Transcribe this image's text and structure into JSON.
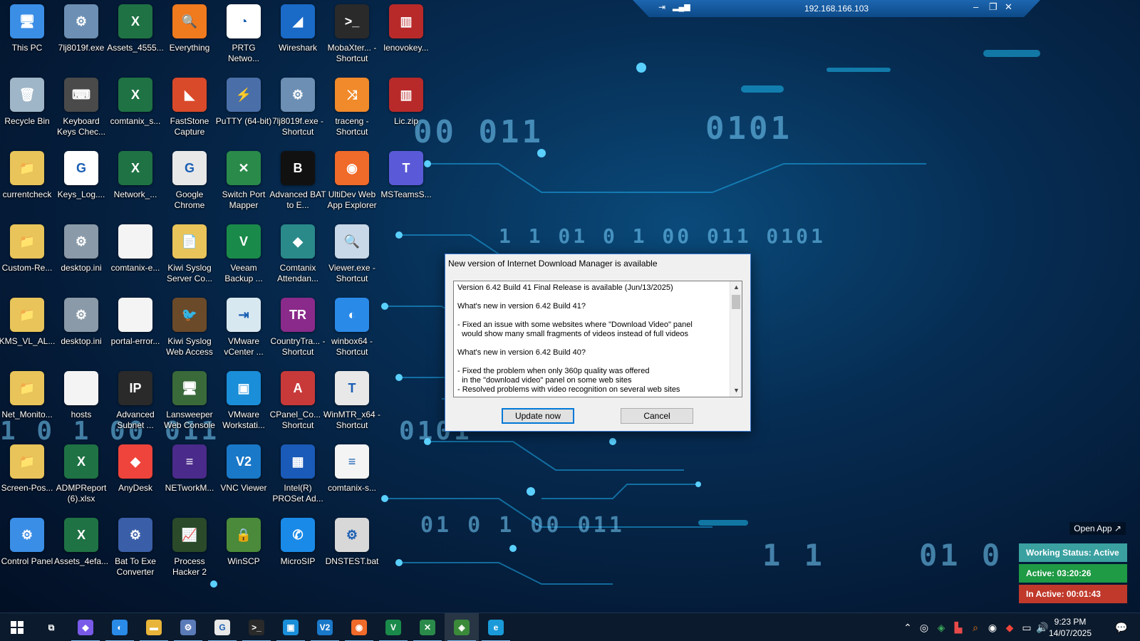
{
  "rdp": {
    "title": "192.168.166.103",
    "pin_icon": "pin-icon",
    "minimize": "–",
    "restore": "❐",
    "close": "✕"
  },
  "background": {
    "digits": [
      "0101",
      "1 1  01 0 1  00 011  0101",
      "00 011",
      "1 0 1  00 011",
      "01 0 1 00 011",
      "1 1",
      "01 0",
      "0101"
    ]
  },
  "desktop_icons": [
    {
      "label": "This PC",
      "color": "#3a8ee6",
      "glyph": "🖥"
    },
    {
      "label": "Recycle Bin",
      "color": "#9fb6c8",
      "glyph": "🗑"
    },
    {
      "label": "currentcheck",
      "color": "#e8c45a",
      "glyph": "📁"
    },
    {
      "label": "Custom-Re...",
      "color": "#e8c45a",
      "glyph": "📁"
    },
    {
      "label": "KMS_VL_AL...",
      "color": "#e8c45a",
      "glyph": "📁"
    },
    {
      "label": "Net_Monito...",
      "color": "#e8c45a",
      "glyph": "📁"
    },
    {
      "label": "Screen-Pos...",
      "color": "#e8c45a",
      "glyph": "📁"
    },
    {
      "label": "Control Panel",
      "color": "#3a8ee6",
      "glyph": "⚙"
    },
    {
      "label": "7lj8019f.exe",
      "color": "#6c8fb3",
      "glyph": "⚙"
    },
    {
      "label": "Keyboard Keys Chec...",
      "color": "#4a4a4a",
      "glyph": "⌨"
    },
    {
      "label": "Keys_Log....",
      "color": "#ffffff",
      "glyph": "G"
    },
    {
      "label": "desktop.ini",
      "color": "#8a9aa8",
      "glyph": "⚙"
    },
    {
      "label": "desktop.ini",
      "color": "#8a9aa8",
      "glyph": "⚙"
    },
    {
      "label": "hosts",
      "color": "#f4f4f4",
      "glyph": ""
    },
    {
      "label": "ADMPReport (6).xlsx",
      "color": "#1f7244",
      "glyph": "X"
    },
    {
      "label": "Assets_4efa...",
      "color": "#1f7244",
      "glyph": "X"
    },
    {
      "label": "Assets_4555...",
      "color": "#1f7244",
      "glyph": "X"
    },
    {
      "label": "comtanix_s...",
      "color": "#1f7244",
      "glyph": "X"
    },
    {
      "label": "Network_...",
      "color": "#1f7244",
      "glyph": "X"
    },
    {
      "label": "comtanix-e...",
      "color": "#f4f4f4",
      "glyph": ""
    },
    {
      "label": "portal-error...",
      "color": "#f4f4f4",
      "glyph": ""
    },
    {
      "label": "Advanced Subnet ...",
      "color": "#2a2a2a",
      "glyph": "IP"
    },
    {
      "label": "AnyDesk",
      "color": "#ef443b",
      "glyph": "◆"
    },
    {
      "label": "Bat To Exe Converter",
      "color": "#3a5fa8",
      "glyph": "⚙"
    },
    {
      "label": "Everything",
      "color": "#f07a1e",
      "glyph": "🔍"
    },
    {
      "label": "FastStone Capture",
      "color": "#d94a2a",
      "glyph": "◣"
    },
    {
      "label": "Google Chrome",
      "color": "#e8e8e8",
      "glyph": "G"
    },
    {
      "label": "Kiwi Syslog Server Co...",
      "color": "#e8c45a",
      "glyph": "📄"
    },
    {
      "label": "Kiwi Syslog Web Access",
      "color": "#6b4a2a",
      "glyph": "🐦"
    },
    {
      "label": "Lansweeper Web Console",
      "color": "#3a6a3a",
      "glyph": "🖥"
    },
    {
      "label": "NETworkM...",
      "color": "#4a2a8a",
      "glyph": "≡"
    },
    {
      "label": "Process Hacker 2",
      "color": "#2a4a2a",
      "glyph": "📈"
    },
    {
      "label": "PRTG Netwo...",
      "color": "#ffffff",
      "glyph": "◔"
    },
    {
      "label": "PuTTY (64-bit)",
      "color": "#4a6fa8",
      "glyph": "⚡"
    },
    {
      "label": "Switch Port Mapper",
      "color": "#2a8a4a",
      "glyph": "✕"
    },
    {
      "label": "Veeam Backup ...",
      "color": "#1a8a4a",
      "glyph": "V"
    },
    {
      "label": "VMware vCenter ...",
      "color": "#d8e8f0",
      "glyph": "⇥"
    },
    {
      "label": "VMware Workstati...",
      "color": "#1a8ed8",
      "glyph": "▣"
    },
    {
      "label": "VNC Viewer",
      "color": "#1a78c8",
      "glyph": "V2"
    },
    {
      "label": "WinSCP",
      "color": "#4a8a3a",
      "glyph": "🔒"
    },
    {
      "label": "Wireshark",
      "color": "#1a6ac8",
      "glyph": "◢"
    },
    {
      "label": "7lj8019f.exe - Shortcut",
      "color": "#6c8fb3",
      "glyph": "⚙"
    },
    {
      "label": "Advanced BAT to E...",
      "color": "#111111",
      "glyph": "B"
    },
    {
      "label": "Comtanix Attendan...",
      "color": "#2a8a8a",
      "glyph": "◆"
    },
    {
      "label": "CountryTra... - Shortcut",
      "color": "#8a2a8a",
      "glyph": "TR"
    },
    {
      "label": "CPanel_Co... - Shortcut",
      "color": "#c83a3a",
      "glyph": "A"
    },
    {
      "label": "Intel(R) PROSet Ad...",
      "color": "#1a5ab8",
      "glyph": "▦"
    },
    {
      "label": "MicroSIP",
      "color": "#1a8ae8",
      "glyph": "✆"
    },
    {
      "label": "MobaXter... - Shortcut",
      "color": "#2a2a2a",
      "glyph": ">_"
    },
    {
      "label": "traceng - Shortcut",
      "color": "#f08a2a",
      "glyph": "⤨"
    },
    {
      "label": "UltiDev Web App Explorer",
      "color": "#f06a2a",
      "glyph": "◉"
    },
    {
      "label": "Viewer.exe - Shortcut",
      "color": "#c8d8e8",
      "glyph": "🔍"
    },
    {
      "label": "winbox64 - Shortcut",
      "color": "#2a8ae8",
      "glyph": "◐"
    },
    {
      "label": "WinMTR_x64 - Shortcut",
      "color": "#e8e8e8",
      "glyph": "T"
    },
    {
      "label": "comtanix-s...",
      "color": "#f4f4f4",
      "glyph": "≡"
    },
    {
      "label": "DNSTEST.bat",
      "color": "#d8d8d8",
      "glyph": "⚙"
    },
    {
      "label": "lenovokey...",
      "color": "#b82a2a",
      "glyph": "▥"
    },
    {
      "label": "Lic.zip",
      "color": "#b82a2a",
      "glyph": "▥"
    },
    {
      "label": "MSTeamsS...",
      "color": "#5a5ad8",
      "glyph": "T"
    }
  ],
  "dialog": {
    "title": "New version of Internet Download Manager is available",
    "lines": [
      "Version 6.42 Build 41 Final Release is available (Jun/13/2025)",
      "",
      "What's new in version 6.42 Build 41?",
      "",
      "- Fixed an issue with some websites where \"Download Video\" panel",
      "  would show many small fragments of videos instead of full videos",
      "",
      "What's new in version 6.42 Build 40?",
      "",
      "- Fixed the problem when only 360p quality was offered",
      "  in the \"download video\" panel on some web sites",
      "- Resolved problems with video recognition on several web sites"
    ],
    "update_label": "Update now",
    "cancel_label": "Cancel"
  },
  "tracker": {
    "open_label": "Open App ↗",
    "status": "Working Status: Active",
    "active": "Active: 03:20:26",
    "inactive": "In Active: 00:01:43",
    "status_color": "#3aa0a0",
    "active_color": "#1f9a45",
    "inactive_color": "#c0392b"
  },
  "taskbar": {
    "start_icon": "windows-start-icon",
    "apps": [
      {
        "name": "task-view",
        "color": "transparent",
        "glyph": "⧉"
      },
      {
        "name": "copilot",
        "color": "#7a5ae8",
        "glyph": "◆"
      },
      {
        "name": "winbox",
        "color": "#2a8ae8",
        "glyph": "◐"
      },
      {
        "name": "file-explorer",
        "color": "#e8b43a",
        "glyph": "▬"
      },
      {
        "name": "network-app",
        "color": "#5a7ab8",
        "glyph": "⚙"
      },
      {
        "name": "chrome",
        "color": "#e8e8e8",
        "glyph": "G"
      },
      {
        "name": "terminal",
        "color": "#2a2a2a",
        "glyph": ">_"
      },
      {
        "name": "vmware-workstation",
        "color": "#1a8ed8",
        "glyph": "▣"
      },
      {
        "name": "vnc-viewer",
        "color": "#1a78c8",
        "glyph": "V2"
      },
      {
        "name": "ultidev",
        "color": "#f06a2a",
        "glyph": "◉"
      },
      {
        "name": "veeam",
        "color": "#1a8a4a",
        "glyph": "V"
      },
      {
        "name": "switch-port-mapper",
        "color": "#2a8a4a",
        "glyph": "✕"
      },
      {
        "name": "remote-desktop",
        "color": "#3a8a3a",
        "glyph": "◈"
      },
      {
        "name": "edge",
        "color": "#1a9ad8",
        "glyph": "e"
      }
    ],
    "time": "9:23 PM",
    "date": "14/07/2025"
  }
}
